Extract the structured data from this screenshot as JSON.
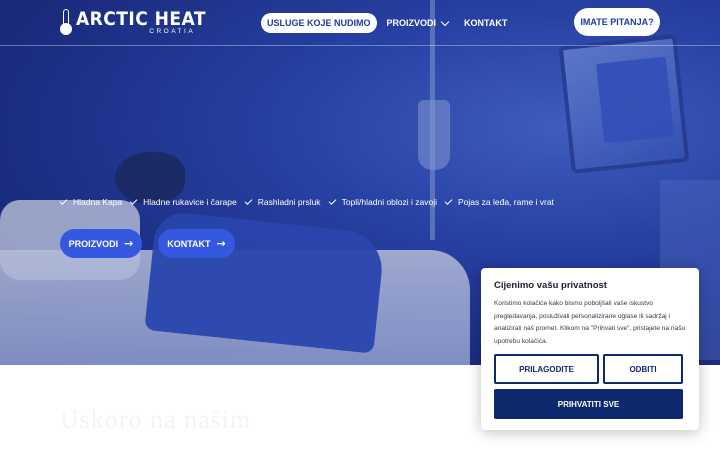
{
  "brand": {
    "name": "ARCTIC HEAT",
    "sub": "CROATIA"
  },
  "nav": {
    "items": [
      {
        "label": "USLUGE KOJE NUDIMO"
      },
      {
        "label": "PROIZVODI"
      },
      {
        "label": "KONTAKT"
      }
    ],
    "cta_label": "IMATE PITANJA?"
  },
  "hero": {
    "features": [
      "Hladna Kapa",
      "Hladne rukavice i čarape",
      "Rashladni prsluk",
      "Topli/hladni oblozi i zavoji",
      "Pojas za leđa, rame i vrat"
    ],
    "buttons": {
      "products": "PROIZVODI",
      "contact": "KONTAKT"
    }
  },
  "section": {
    "heading_faded": "Uskoro na našim"
  },
  "cookie": {
    "title": "Cijenimo vašu privatnost",
    "text": "Koristimo kolačiće kako bismo poboljšali vaše iskustvo pregledavanja, posluživali personalizirane oglase ili sadržaj i analizirali naš promet. Klikom na \"Prihvati sve\", pristajete na našu upotrebu kolačića.",
    "customize_label": "PRILAGODITE",
    "reject_label": "ODBITI",
    "accept_label": "PRIHVATITI SVE"
  },
  "colors": {
    "hero_blue": "#2c49b4",
    "button_blue": "#3558e0",
    "cookie_navy": "#0d2a6e"
  }
}
